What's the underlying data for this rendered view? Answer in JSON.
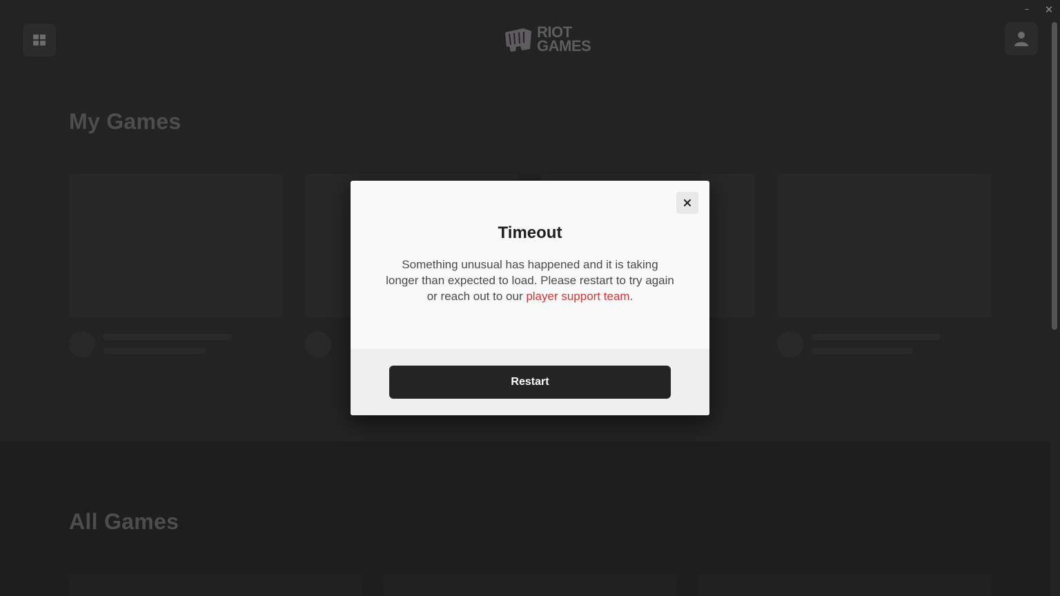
{
  "window": {
    "minimize_glyph": "–",
    "close_glyph": "✕"
  },
  "header": {
    "apps_icon": "grid-icon",
    "logo": {
      "line1": "RIOT",
      "line2": "GAMES",
      "icon": "fist-icon"
    },
    "profile_icon": "user-icon"
  },
  "sections": {
    "my_games_title": "My Games",
    "all_games_title": "All Games"
  },
  "modal": {
    "title": "Timeout",
    "body_text": "Something unusual has happened and it is taking longer than expected to load. Please restart to try again or reach out to our ",
    "link_text": "player support team",
    "body_end": ".",
    "restart_label": "Restart",
    "close_icon": "close-icon"
  },
  "colors": {
    "background": "#242324",
    "modal_bg": "#f9f9f9",
    "link": "#d13639",
    "button_bg": "#252425"
  }
}
